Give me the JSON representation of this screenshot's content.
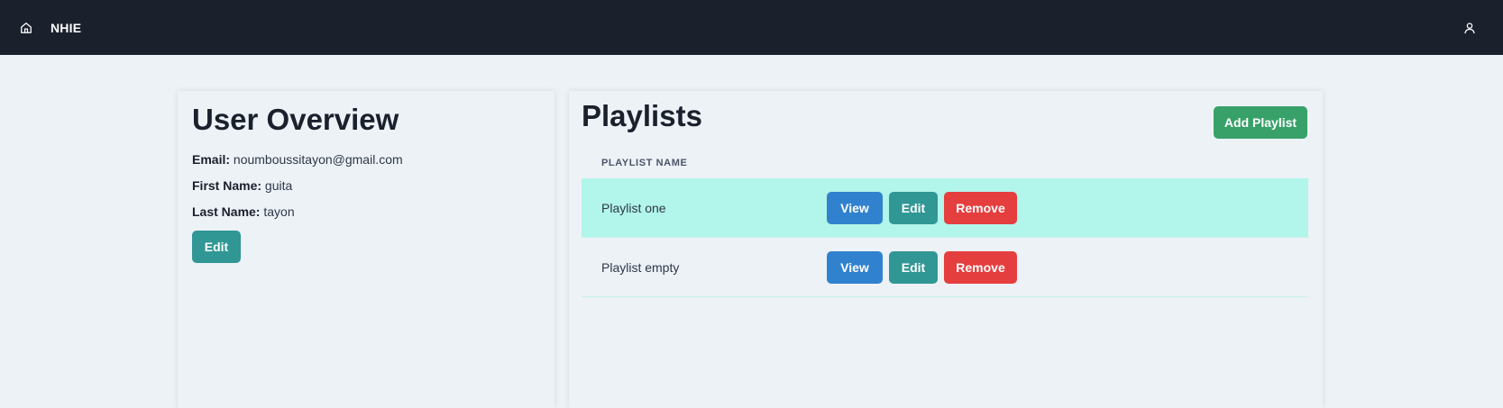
{
  "app": {
    "brand": "NHIE"
  },
  "icons": {
    "home": "home-icon",
    "user": "user-icon"
  },
  "user_overview": {
    "title": "User Overview",
    "email_label": "Email:",
    "email": "noumboussitayon@gmail.com",
    "first_name_label": "First Name:",
    "first_name": "guita",
    "last_name_label": "Last Name:",
    "last_name": "tayon",
    "edit_label": "Edit"
  },
  "playlists": {
    "title": "Playlists",
    "add_label": "Add Playlist",
    "column_header": "Playlist Name",
    "rows": [
      {
        "name": "Playlist one",
        "view": "View",
        "edit": "Edit",
        "remove": "Remove",
        "highlighted": true
      },
      {
        "name": "Playlist empty",
        "view": "View",
        "edit": "Edit",
        "remove": "Remove",
        "highlighted": false
      }
    ]
  },
  "colors": {
    "topbar": "#1a202c",
    "background": "#edf2f7",
    "view": "#3182ce",
    "edit": "#319795",
    "remove": "#e53e3e",
    "add": "#38a169",
    "row_highlight": "#b2f5ea"
  }
}
